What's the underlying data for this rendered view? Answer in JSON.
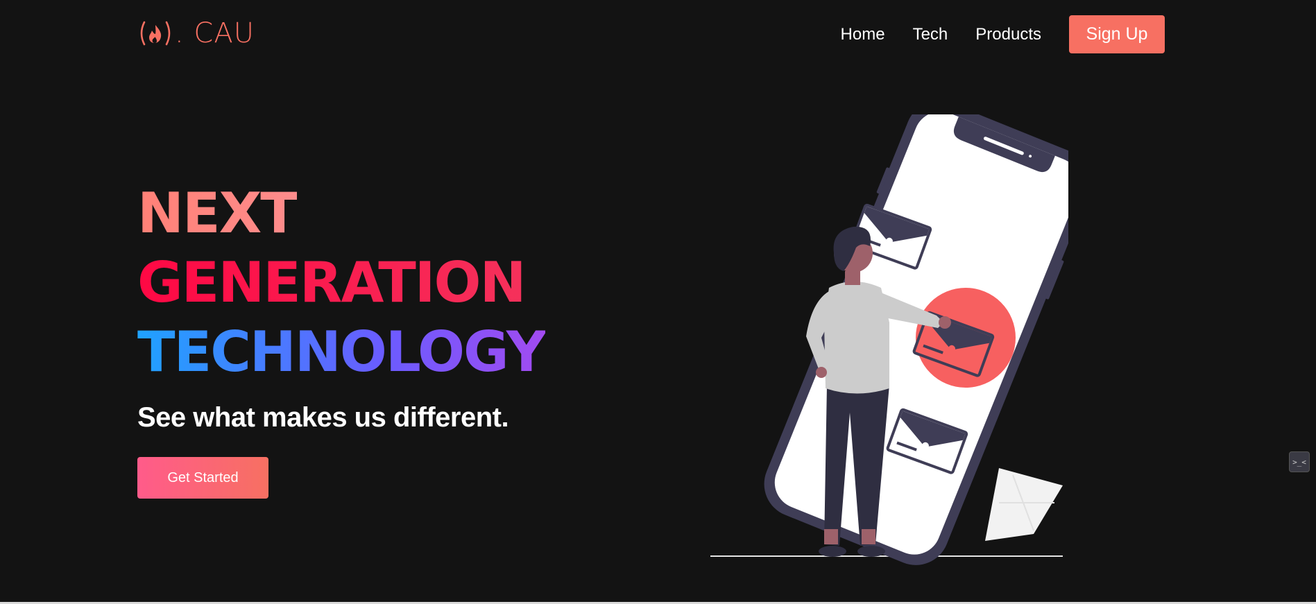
{
  "navbar": {
    "logo_text": ". CAU",
    "links": [
      "Home",
      "Tech",
      "Products"
    ],
    "signup_label": "Sign Up"
  },
  "hero": {
    "line1": "NEXT",
    "line2": "GENERATION",
    "line3": "TECHNOLOGY",
    "subtitle": "See what makes us different.",
    "cta_label": "Get Started"
  },
  "widget": {
    "label": ">_<"
  },
  "colors": {
    "background": "#131313",
    "accent": "#f77062",
    "phone_frame": "#3f3d56",
    "highlight_circle": "#f76060"
  },
  "icons": [
    "fire-icon",
    "envelope-icon"
  ]
}
